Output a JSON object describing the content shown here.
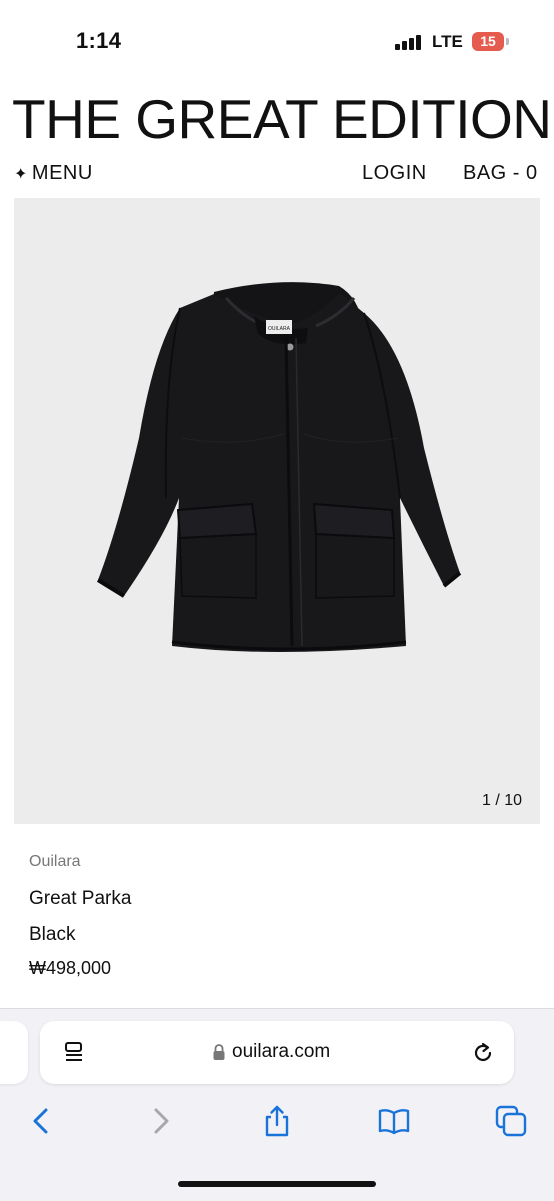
{
  "status_bar": {
    "time": "1:14",
    "network": "LTE",
    "battery": "15",
    "battery_color": "#e55b4d"
  },
  "site": {
    "title": "THE GREAT EDITION",
    "menu_label": "MENU",
    "menu_icon": "sparkle-icon",
    "login_label": "LOGIN",
    "bag_label": "BAG - 0"
  },
  "product": {
    "image_counter": "1 / 10",
    "brand": "Ouilara",
    "name": "Great Parka",
    "color": "Black",
    "price": "₩498,000",
    "label_text": "OUILARA"
  },
  "browser": {
    "url": "ouilara.com",
    "icons": [
      "reader-mode-icon",
      "lock-icon",
      "reload-icon",
      "back-icon",
      "forward-icon",
      "share-icon",
      "bookmarks-icon",
      "tabs-icon"
    ],
    "accent_color": "#1a73d9"
  }
}
